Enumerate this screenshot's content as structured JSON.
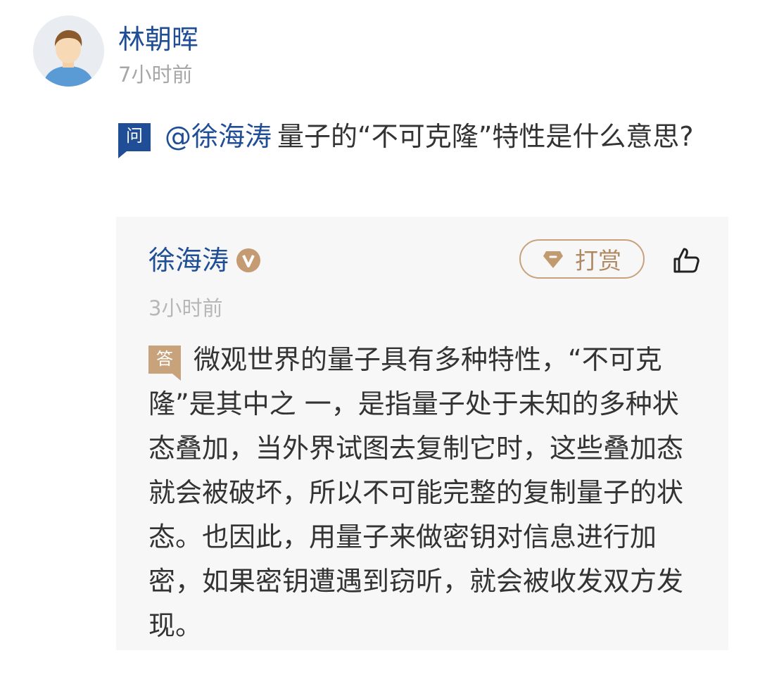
{
  "post": {
    "author": "林朝晖",
    "time": "7小时前",
    "question_badge": "问",
    "mention": "@徐海涛",
    "question": "量子的“不可克隆”特性是什么意思?"
  },
  "answer": {
    "author": "徐海涛",
    "verified_icon": "v-badge-icon",
    "reward_label": "打赏",
    "reward_icon": "gem-icon",
    "like_icon": "thumbs-up-icon",
    "time": "3小时前",
    "answer_badge": "答",
    "text": "微观世界的量子具有多种特性，“不可克隆”是其中之 一，是指量子处于未知的多种状态叠加，当外界试图去复制它时，这些叠加态就会被破坏，所以不可能完整的复制量子的状态。也因此，用量子来做密钥对信息进行加密，如果密钥遭遇到窃听，就会被收发双方发现。"
  },
  "colors": {
    "brand_blue": "#1f4e96",
    "answer_gold": "#c8a27a",
    "card_bg": "#f7f7f7",
    "time_gray": "#a7a7a7"
  }
}
